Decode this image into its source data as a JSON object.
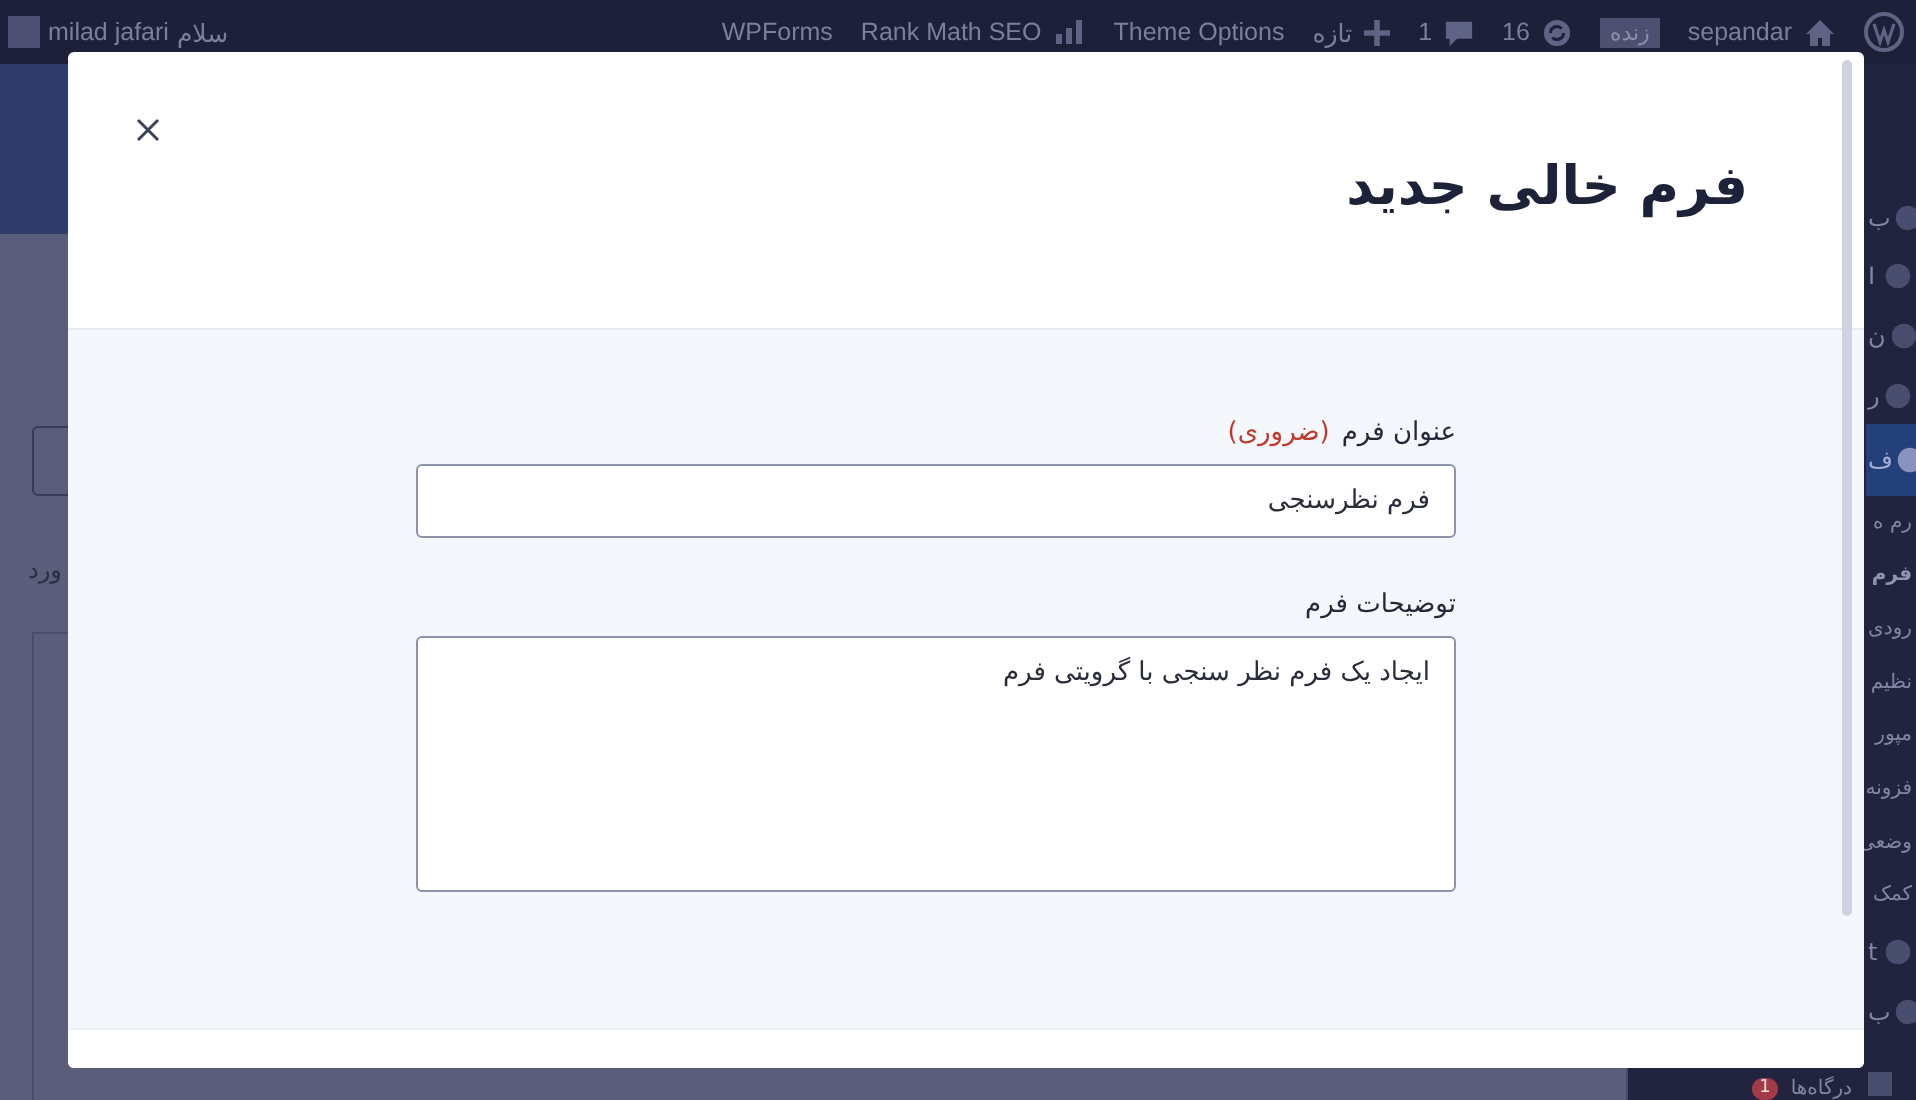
{
  "admin_bar": {
    "items": [
      {
        "kind": "logo"
      },
      {
        "kind": "home",
        "label": "sepandar"
      },
      {
        "kind": "badge",
        "label": "زنده"
      },
      {
        "kind": "updates",
        "label": "16"
      },
      {
        "kind": "comments",
        "label": "1"
      },
      {
        "kind": "new",
        "label": "تازه"
      },
      {
        "kind": "link",
        "label": "Theme Options"
      },
      {
        "kind": "rankmath",
        "label": "Rank Math SEO"
      },
      {
        "kind": "link",
        "label": "WPForms"
      }
    ],
    "account": {
      "greeting": "سلام",
      "name": "milad jafari"
    }
  },
  "background": {
    "left_text": "ورد",
    "sidebar": [
      {
        "kind": "gauge",
        "label": "ب",
        "selected": false
      },
      {
        "kind": "group",
        "label": "I",
        "selected": false
      },
      {
        "kind": "pin",
        "label": "ن",
        "selected": false
      },
      {
        "kind": "plugin",
        "label": "ر",
        "selected": false
      },
      {
        "kind": "forms",
        "label": "ف",
        "selected": true
      },
      {
        "kind": "sub",
        "label": "رم ه",
        "selected": false
      },
      {
        "kind": "sub",
        "label": "فرم",
        "selected": true
      },
      {
        "kind": "sub",
        "label": "رودی",
        "selected": false
      },
      {
        "kind": "sub",
        "label": "نظیم",
        "selected": false
      },
      {
        "kind": "sub",
        "label": "مپور",
        "selected": false
      },
      {
        "kind": "sub",
        "label": "فزونه",
        "selected": false
      },
      {
        "kind": "sub",
        "label": "وضعی",
        "selected": false
      },
      {
        "kind": "sub",
        "label": "کمک",
        "selected": false
      },
      {
        "kind": "at",
        "label": "t",
        "selected": false
      },
      {
        "kind": "page",
        "label": "ب",
        "selected": false
      }
    ],
    "bottom_item": {
      "label": "درگاه‌ها",
      "count": "1"
    }
  },
  "modal": {
    "title": "فرم خالی جدید",
    "fields": [
      {
        "kind": "input",
        "label": "عنوان فرم",
        "required_note": "(ضروری)",
        "value": "فرم نظرسنجی"
      },
      {
        "kind": "textarea",
        "label": "توضیحات فرم",
        "value": "ایجاد یک فرم نظر سنجی با گرویتی فرم"
      }
    ]
  }
}
